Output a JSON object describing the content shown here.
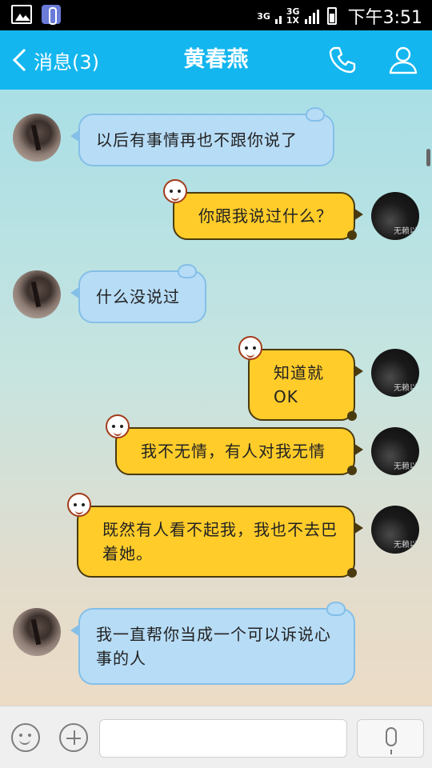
{
  "status_bar": {
    "network_1": "3G",
    "network_2": "3G",
    "network_2_sub": "1X",
    "time": "下午3:51"
  },
  "header": {
    "back_label": "消息(3)",
    "title": "黄春燕",
    "phone_icon": "phone-icon",
    "contact_icon": "contact-icon"
  },
  "messages": [
    {
      "side": "left",
      "text": "以后有事情再也不跟你说了"
    },
    {
      "side": "right",
      "text": "你跟我说过什么？"
    },
    {
      "side": "left",
      "text": "什么没说过"
    },
    {
      "side": "right",
      "text": "知道就OK"
    },
    {
      "side": "right",
      "text": "我不无情，有人对我无情"
    },
    {
      "side": "right",
      "text": "既然有人看不起我，我也不去巴着她。"
    },
    {
      "side": "left",
      "text": "我一直帮你当成一个可以诉说心事的人"
    }
  ],
  "my_avatar_caption": "无赖以",
  "input": {
    "value": "",
    "placeholder": ""
  },
  "colors": {
    "header": "#13b6ef",
    "left_bubble": "#b7dcf6",
    "right_bubble": "#ffcc2a"
  }
}
